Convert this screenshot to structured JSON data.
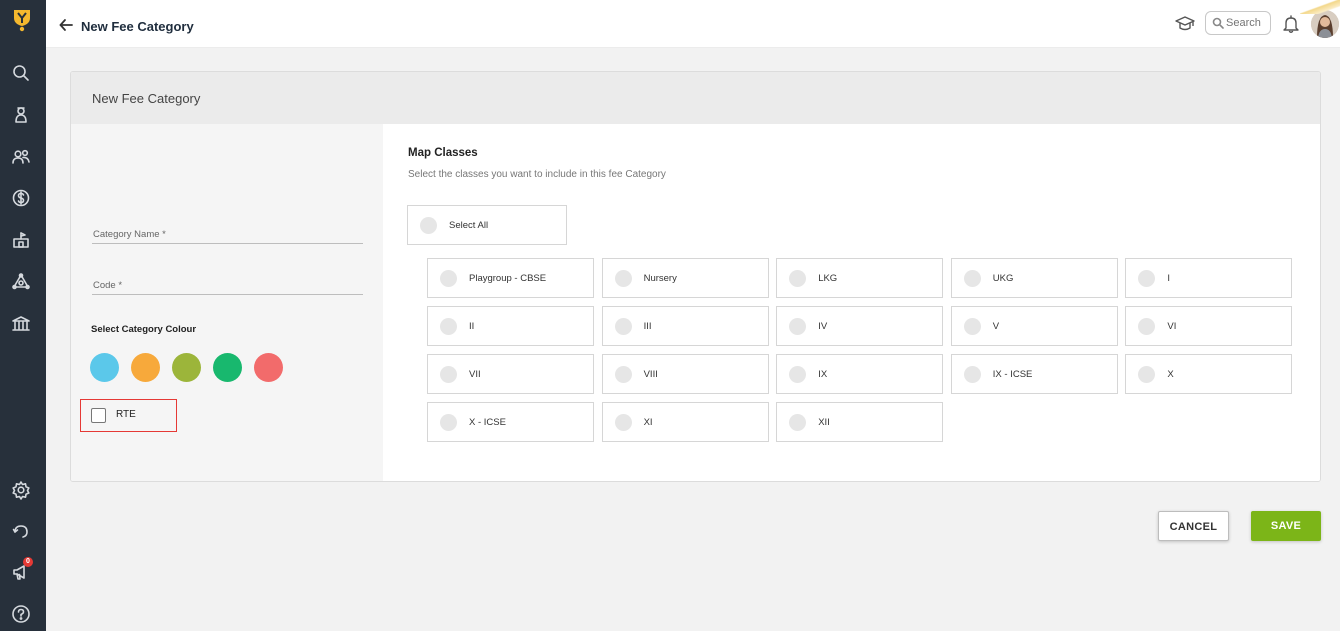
{
  "topbar": {
    "title": "New Fee Category",
    "search_placeholder": "Search",
    "notification_count": "0"
  },
  "card": {
    "title": "New Fee Category",
    "fields": {
      "category_name_placeholder": "Category Name *",
      "code_placeholder": "Code *"
    },
    "colour_label": "Select Category Colour",
    "colours": [
      "#5bc8ea",
      "#f7a93b",
      "#9cb53a",
      "#18b86e",
      "#f26b6b"
    ],
    "rte_label": "RTE",
    "map": {
      "title": "Map Classes",
      "description": "Select the classes you want to include in this fee Category",
      "select_all": "Select All",
      "classes": [
        "Playgroup - CBSE",
        "Nursery",
        "LKG",
        "UKG",
        "I",
        "II",
        "III",
        "IV",
        "V",
        "VI",
        "VII",
        "VIII",
        "IX",
        "IX - ICSE",
        "X",
        "X - ICSE",
        "XI",
        "XII"
      ]
    }
  },
  "actions": {
    "cancel": "CANCEL",
    "save": "SAVE"
  },
  "colors": {
    "sidebar": "#27303b",
    "accent_green": "#7cb518",
    "highlight_red": "#e53935"
  }
}
